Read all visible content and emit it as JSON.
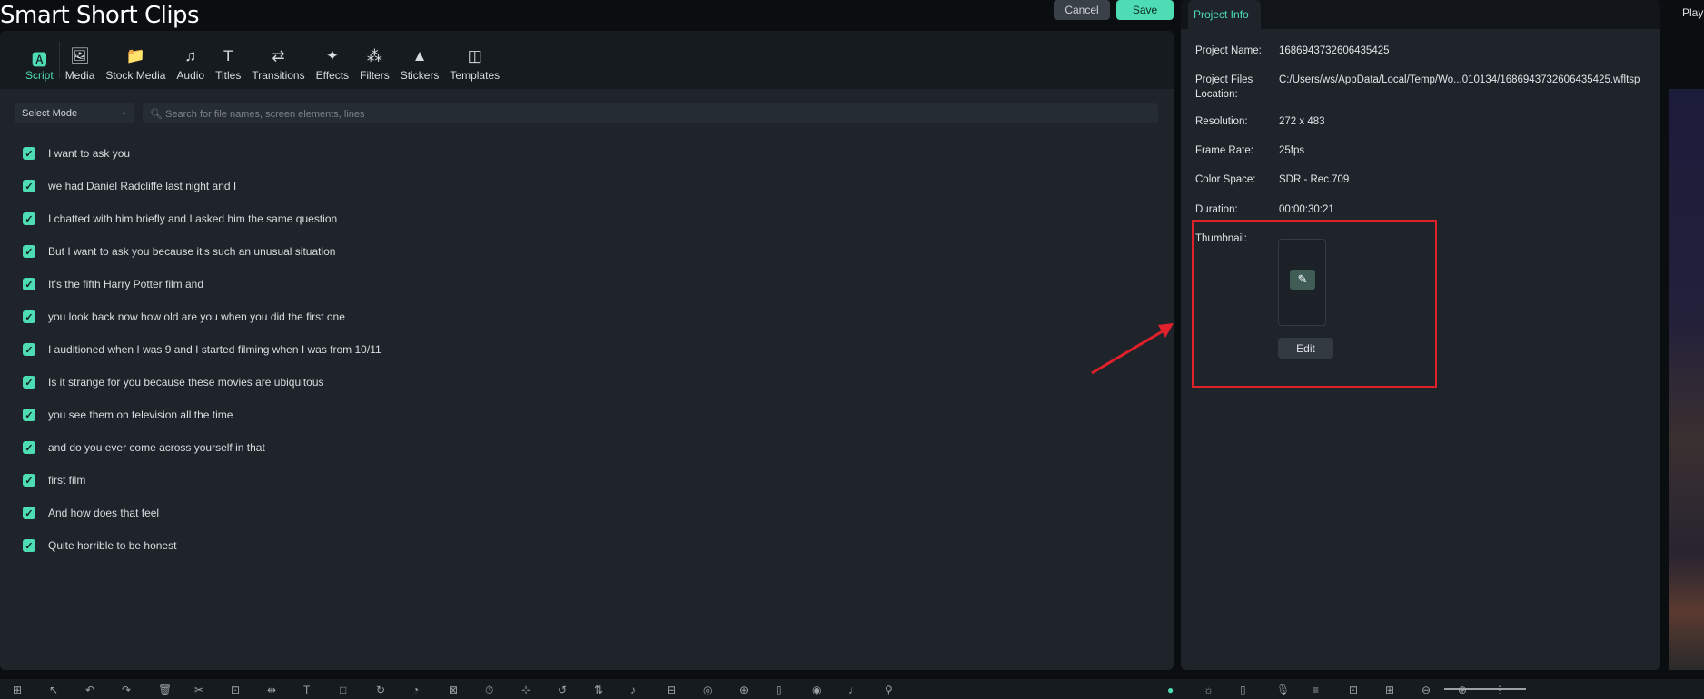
{
  "app": {
    "title": "Smart Short Clips",
    "cancel": "Cancel",
    "save": "Save"
  },
  "tabs": [
    {
      "label": "Script",
      "icon": "script-icon",
      "glyph": "🅰"
    },
    {
      "label": "Media",
      "icon": "media-icon",
      "glyph": "🖼"
    },
    {
      "label": "Stock Media",
      "icon": "stock-media-icon",
      "glyph": "📁"
    },
    {
      "label": "Audio",
      "icon": "audio-icon",
      "glyph": "♫"
    },
    {
      "label": "Titles",
      "icon": "titles-icon",
      "glyph": "T"
    },
    {
      "label": "Transitions",
      "icon": "transitions-icon",
      "glyph": "⇄"
    },
    {
      "label": "Effects",
      "icon": "effects-icon",
      "glyph": "✦"
    },
    {
      "label": "Filters",
      "icon": "filters-icon",
      "glyph": "⁂"
    },
    {
      "label": "Stickers",
      "icon": "stickers-icon",
      "glyph": "▲"
    },
    {
      "label": "Templates",
      "icon": "templates-icon",
      "glyph": "◫"
    }
  ],
  "mode": {
    "value": "Select Mode"
  },
  "search": {
    "placeholder": "Search for file names, screen elements, lines"
  },
  "lines": [
    "I want to ask you",
    "we had Daniel Radcliffe last night and I",
    "I chatted with him briefly and I asked him the same question",
    "But I want to ask you because it's such an unusual situation",
    "It's the fifth Harry Potter film and",
    "you look back now how old are you when you did the first one",
    "I auditioned when I was 9 and I started filming when I was from 10/11",
    "Is it strange for you because these movies are ubiquitous",
    "you see them on television all the time",
    "and do you ever come across yourself in that",
    "first film",
    "And how does that feel",
    "Quite horrible to be honest"
  ],
  "project_info": {
    "tab": "Project Info",
    "fields": [
      {
        "label": "Project Name:",
        "value": "1686943732606435425"
      },
      {
        "label": "Project Files Location:",
        "value": "C:/Users/ws/AppData/Local/Temp/Wo...010134/1686943732606435425.wfltsp"
      },
      {
        "label": "Resolution:",
        "value": "272 x 483"
      },
      {
        "label": "Frame Rate:",
        "value": "25fps"
      },
      {
        "label": "Color Space:",
        "value": "SDR - Rec.709"
      },
      {
        "label": "Duration:",
        "value": "00:00:30:21"
      }
    ],
    "thumbnail_label": "Thumbnail:",
    "edit": "Edit"
  },
  "player": {
    "label": "Play"
  },
  "colors": {
    "accent": "#4ddcb4",
    "highlight": "#e0202a"
  }
}
